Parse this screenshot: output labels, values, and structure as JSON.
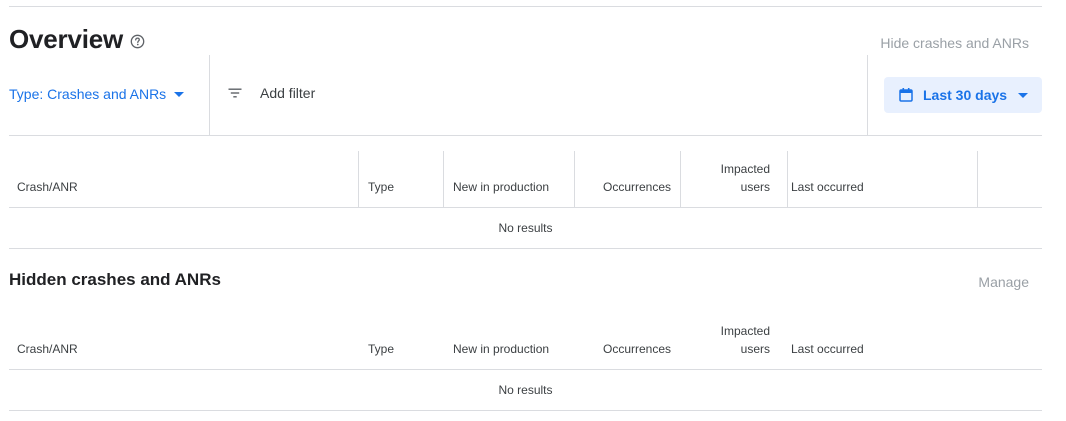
{
  "overview": {
    "title": "Overview",
    "hide_link": "Hide crashes and ANRs"
  },
  "filters": {
    "type_label": "Type: Crashes and ANRs",
    "add_filter_label": "Add filter",
    "date_range_label": "Last 30 days"
  },
  "main_table": {
    "columns": {
      "crash": "Crash/ANR",
      "type": "Type",
      "new_in_production": "New in production",
      "occurrences": "Occurrences",
      "impacted_users_1": "Impacted",
      "impacted_users_2": "users",
      "last_occurred": "Last occurred"
    },
    "empty_message": "No results"
  },
  "hidden_section": {
    "title": "Hidden crashes and ANRs",
    "manage_link": "Manage"
  },
  "hidden_table": {
    "columns": {
      "crash": "Crash/ANR",
      "type": "Type",
      "new_in_production": "New in production",
      "occurrences": "Occurrences",
      "impacted_users_1": "Impacted",
      "impacted_users_2": "users",
      "last_occurred": "Last occurred"
    },
    "empty_message": "No results"
  },
  "icons": {
    "help": "help-circle-icon",
    "filter": "filter-list-icon",
    "calendar": "calendar-icon",
    "dropdown": "arrow-drop-down-icon"
  },
  "colors": {
    "accent": "#1a73e8",
    "accent_bg": "#e8f0fe",
    "muted_link": "#9aa0a6",
    "divider": "#dadce0"
  }
}
